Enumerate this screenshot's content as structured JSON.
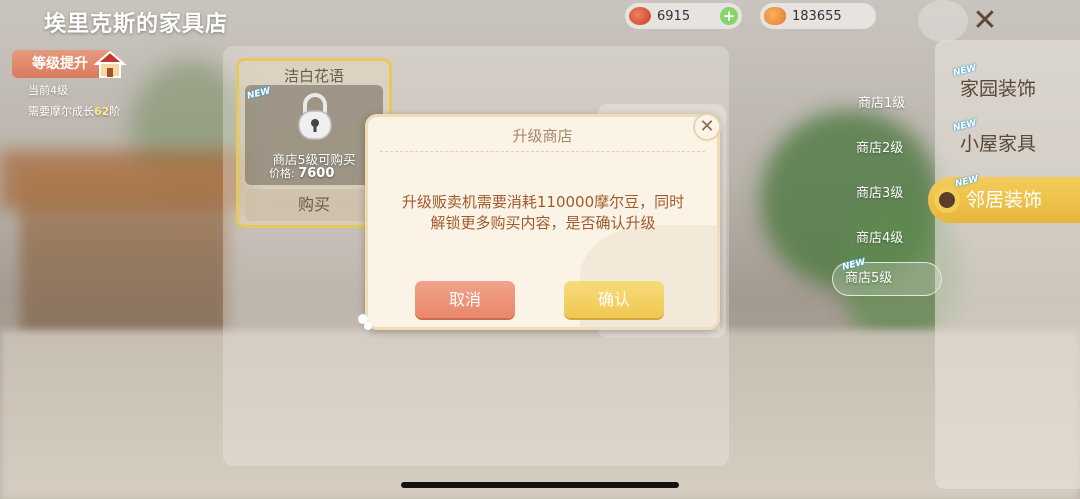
{
  "header": {
    "shop_title": "埃里克斯的家具店",
    "currency1": {
      "value": "6915",
      "icon": "red-gem-icon",
      "plus": "+"
    },
    "currency2": {
      "value": "183655",
      "icon": "bean-icon"
    },
    "close": "✕"
  },
  "level": {
    "button_label": "等级提升",
    "current": "当前4级",
    "need_prefix": "需要摩尔成长",
    "need_value": "62",
    "need_suffix": "阶"
  },
  "item": {
    "name": "洁白花语",
    "new_tag": "NEW",
    "lock_text": "商店5级可购买",
    "price_label": "价格:",
    "price_value": "7600",
    "buy_label": "购买"
  },
  "shop_levels": [
    "商店1级",
    "商店2级",
    "商店3级",
    "商店4级",
    "商店5级"
  ],
  "shop_level_new_tag": "NEW",
  "categories": [
    {
      "label": "家园装饰",
      "new": "NEW"
    },
    {
      "label": "小屋家具",
      "new": "NEW"
    },
    {
      "label": "邻居装饰",
      "new": "NEW"
    }
  ],
  "dialog": {
    "title": "升级商店",
    "message_line1": "升级贩卖机需要消耗110000摩尔豆，同时",
    "message_line2": "解锁更多购买内容，是否确认升级",
    "cancel": "取消",
    "confirm": "确认",
    "close": "✕"
  },
  "colors": {
    "accent_yellow": "#f0c752",
    "cancel_red": "#e9876b",
    "message_text": "#a15a2d",
    "level_button": "#d97a5d"
  }
}
